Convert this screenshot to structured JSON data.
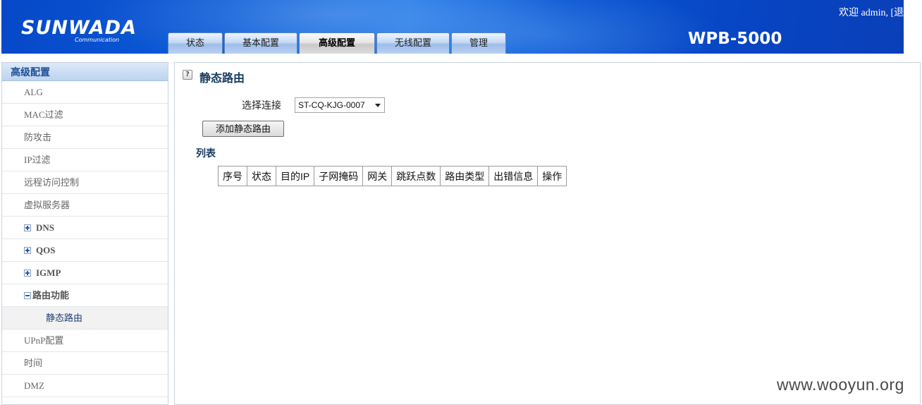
{
  "header": {
    "logo_text": "SUNWADA",
    "logo_sub": "Communication",
    "model": "WPB-5000",
    "welcome": "欢迎 admin, [退出]",
    "tabs": [
      {
        "label": "状态",
        "active": false
      },
      {
        "label": "基本配置",
        "active": false
      },
      {
        "label": "高级配置",
        "active": true
      },
      {
        "label": "无线配置",
        "active": false
      },
      {
        "label": "管理",
        "active": false
      }
    ]
  },
  "sidebar": {
    "title": "高级配置",
    "items": [
      {
        "label": "ALG"
      },
      {
        "label": "MAC过滤"
      },
      {
        "label": "防攻击"
      },
      {
        "label": "IP过滤"
      },
      {
        "label": "远程访问控制"
      },
      {
        "label": "虚拟服务器"
      },
      {
        "label": "DNS",
        "toggle": "expand"
      },
      {
        "label": "QOS",
        "toggle": "expand"
      },
      {
        "label": "IGMP",
        "toggle": "expand"
      },
      {
        "label": "路由功能",
        "toggle": "collapse"
      },
      {
        "label": "静态路由",
        "sub": true,
        "selected": true
      },
      {
        "label": "UPnP配置"
      },
      {
        "label": "时间"
      },
      {
        "label": "DMZ"
      }
    ]
  },
  "main": {
    "help_icon": "question-icon",
    "page_title": "静态路由",
    "connection_label": "选择连接",
    "connection_value": "ST-CQ-KJG-0007",
    "add_button": "添加静态路由",
    "list_title": "列表",
    "table_headers": [
      "序号",
      "状态",
      "目的IP",
      "子网掩码",
      "网关",
      "跳跃点数",
      "路由类型",
      "出错信息",
      "操作"
    ]
  },
  "watermark": "www.wooyun.org"
}
